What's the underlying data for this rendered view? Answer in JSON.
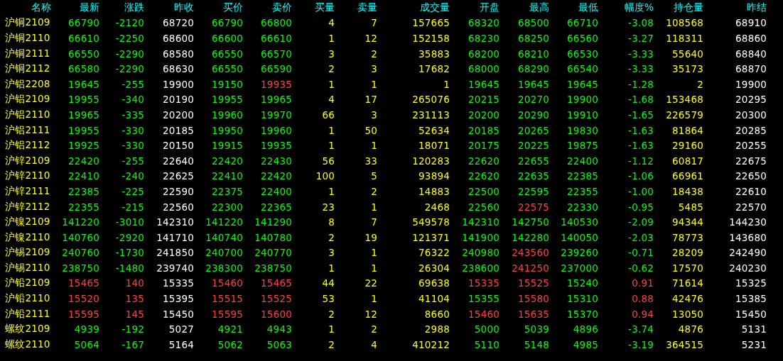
{
  "table": {
    "columns": [
      "名称",
      "最新",
      "涨跌",
      "昨收",
      "买价",
      "卖价",
      "买量",
      "卖量",
      "成交量",
      "开盘",
      "最高",
      "最低",
      "幅度%",
      "持仓量",
      "昨结"
    ],
    "rows": [
      {
        "cells": [
          {
            "text": "沪铜2109",
            "color": "#ffff00"
          },
          {
            "text": "66790",
            "color": "#00ff00"
          },
          {
            "text": "-2120",
            "color": "#00ff00"
          },
          {
            "text": "68720",
            "color": "#ffffff"
          },
          {
            "text": "66790",
            "color": "#00ff00"
          },
          {
            "text": "66800",
            "color": "#00ff00"
          },
          {
            "text": "4",
            "color": "#ffff00"
          },
          {
            "text": "7",
            "color": "#ffff00"
          },
          {
            "text": "157665",
            "color": "#ffff00"
          },
          {
            "text": "68320",
            "color": "#00ff00"
          },
          {
            "text": "68500",
            "color": "#00ff00"
          },
          {
            "text": "66710",
            "color": "#00ff00"
          },
          {
            "text": "-3.08",
            "color": "#00ff00"
          },
          {
            "text": "108568",
            "color": "#ffff00"
          },
          {
            "text": "68910",
            "color": "#ffffff"
          }
        ]
      },
      {
        "cells": [
          {
            "text": "沪铜2110",
            "color": "#ffff00"
          },
          {
            "text": "66610",
            "color": "#00ff00"
          },
          {
            "text": "-2250",
            "color": "#00ff00"
          },
          {
            "text": "68600",
            "color": "#ffffff"
          },
          {
            "text": "66600",
            "color": "#00ff00"
          },
          {
            "text": "66610",
            "color": "#00ff00"
          },
          {
            "text": "1",
            "color": "#ffff00"
          },
          {
            "text": "12",
            "color": "#ffff00"
          },
          {
            "text": "152158",
            "color": "#ffff00"
          },
          {
            "text": "68230",
            "color": "#00ff00"
          },
          {
            "text": "68250",
            "color": "#00ff00"
          },
          {
            "text": "66560",
            "color": "#00ff00"
          },
          {
            "text": "-3.27",
            "color": "#00ff00"
          },
          {
            "text": "118311",
            "color": "#ffff00"
          },
          {
            "text": "68860",
            "color": "#ffffff"
          }
        ]
      },
      {
        "cells": [
          {
            "text": "沪铜2111",
            "color": "#ffff00"
          },
          {
            "text": "66550",
            "color": "#00ff00"
          },
          {
            "text": "-2290",
            "color": "#00ff00"
          },
          {
            "text": "68580",
            "color": "#ffffff"
          },
          {
            "text": "66550",
            "color": "#00ff00"
          },
          {
            "text": "66570",
            "color": "#00ff00"
          },
          {
            "text": "3",
            "color": "#ffff00"
          },
          {
            "text": "2",
            "color": "#ffff00"
          },
          {
            "text": "35883",
            "color": "#ffff00"
          },
          {
            "text": "68200",
            "color": "#00ff00"
          },
          {
            "text": "68210",
            "color": "#00ff00"
          },
          {
            "text": "66530",
            "color": "#00ff00"
          },
          {
            "text": "-3.33",
            "color": "#00ff00"
          },
          {
            "text": "55640",
            "color": "#ffff00"
          },
          {
            "text": "68840",
            "color": "#ffffff"
          }
        ]
      },
      {
        "cells": [
          {
            "text": "沪铜2112",
            "color": "#ffff00"
          },
          {
            "text": "66580",
            "color": "#00ff00"
          },
          {
            "text": "-2290",
            "color": "#00ff00"
          },
          {
            "text": "68630",
            "color": "#ffffff"
          },
          {
            "text": "66550",
            "color": "#00ff00"
          },
          {
            "text": "66590",
            "color": "#00ff00"
          },
          {
            "text": "2",
            "color": "#ffff00"
          },
          {
            "text": "3",
            "color": "#ffff00"
          },
          {
            "text": "17682",
            "color": "#ffff00"
          },
          {
            "text": "68000",
            "color": "#00ff00"
          },
          {
            "text": "68290",
            "color": "#00ff00"
          },
          {
            "text": "66540",
            "color": "#00ff00"
          },
          {
            "text": "-3.33",
            "color": "#00ff00"
          },
          {
            "text": "35173",
            "color": "#ffff00"
          },
          {
            "text": "68870",
            "color": "#ffffff"
          }
        ]
      },
      {
        "cells": [
          {
            "text": "沪铝2208",
            "color": "#ffff00"
          },
          {
            "text": "19645",
            "color": "#00ff00"
          },
          {
            "text": "-255",
            "color": "#00ff00"
          },
          {
            "text": "19900",
            "color": "#ffffff"
          },
          {
            "text": "19150",
            "color": "#00ff00"
          },
          {
            "text": "19935",
            "color": "#ff4040"
          },
          {
            "text": "1",
            "color": "#ffff00"
          },
          {
            "text": "1",
            "color": "#ffff00"
          },
          {
            "text": "1",
            "color": "#ffff00"
          },
          {
            "text": "19645",
            "color": "#00ff00"
          },
          {
            "text": "19645",
            "color": "#00ff00"
          },
          {
            "text": "19645",
            "color": "#00ff00"
          },
          {
            "text": "-1.28",
            "color": "#00ff00"
          },
          {
            "text": "2",
            "color": "#ffff00"
          },
          {
            "text": "19900",
            "color": "#ffffff"
          }
        ]
      },
      {
        "cells": [
          {
            "text": "沪铝2109",
            "color": "#ffff00"
          },
          {
            "text": "19955",
            "color": "#00ff00"
          },
          {
            "text": "-340",
            "color": "#00ff00"
          },
          {
            "text": "20190",
            "color": "#ffffff"
          },
          {
            "text": "19955",
            "color": "#00ff00"
          },
          {
            "text": "19965",
            "color": "#00ff00"
          },
          {
            "text": "4",
            "color": "#ffff00"
          },
          {
            "text": "17",
            "color": "#ffff00"
          },
          {
            "text": "265076",
            "color": "#ffff00"
          },
          {
            "text": "20215",
            "color": "#00ff00"
          },
          {
            "text": "20270",
            "color": "#00ff00"
          },
          {
            "text": "19900",
            "color": "#00ff00"
          },
          {
            "text": "-1.68",
            "color": "#00ff00"
          },
          {
            "text": "153468",
            "color": "#ffff00"
          },
          {
            "text": "20295",
            "color": "#ffffff"
          }
        ]
      },
      {
        "cells": [
          {
            "text": "沪铝2110",
            "color": "#ffff00"
          },
          {
            "text": "19965",
            "color": "#00ff00"
          },
          {
            "text": "-335",
            "color": "#00ff00"
          },
          {
            "text": "20200",
            "color": "#ffffff"
          },
          {
            "text": "19960",
            "color": "#00ff00"
          },
          {
            "text": "19970",
            "color": "#00ff00"
          },
          {
            "text": "66",
            "color": "#ffff00"
          },
          {
            "text": "3",
            "color": "#ffff00"
          },
          {
            "text": "231113",
            "color": "#ffff00"
          },
          {
            "text": "20200",
            "color": "#00ff00"
          },
          {
            "text": "20290",
            "color": "#00ff00"
          },
          {
            "text": "19910",
            "color": "#00ff00"
          },
          {
            "text": "-1.65",
            "color": "#00ff00"
          },
          {
            "text": "226579",
            "color": "#ffff00"
          },
          {
            "text": "20300",
            "color": "#ffffff"
          }
        ]
      },
      {
        "cells": [
          {
            "text": "沪铝2111",
            "color": "#ffff00"
          },
          {
            "text": "19955",
            "color": "#00ff00"
          },
          {
            "text": "-330",
            "color": "#00ff00"
          },
          {
            "text": "20185",
            "color": "#ffffff"
          },
          {
            "text": "19950",
            "color": "#00ff00"
          },
          {
            "text": "19960",
            "color": "#00ff00"
          },
          {
            "text": "1",
            "color": "#ffff00"
          },
          {
            "text": "50",
            "color": "#ffff00"
          },
          {
            "text": "52634",
            "color": "#ffff00"
          },
          {
            "text": "20185",
            "color": "#00ff00"
          },
          {
            "text": "20265",
            "color": "#00ff00"
          },
          {
            "text": "19830",
            "color": "#00ff00"
          },
          {
            "text": "-1.63",
            "color": "#00ff00"
          },
          {
            "text": "81864",
            "color": "#ffff00"
          },
          {
            "text": "20285",
            "color": "#ffffff"
          }
        ]
      },
      {
        "cells": [
          {
            "text": "沪铝2112",
            "color": "#ffff00"
          },
          {
            "text": "19925",
            "color": "#00ff00"
          },
          {
            "text": "-330",
            "color": "#00ff00"
          },
          {
            "text": "20150",
            "color": "#ffffff"
          },
          {
            "text": "19915",
            "color": "#00ff00"
          },
          {
            "text": "19935",
            "color": "#00ff00"
          },
          {
            "text": "1",
            "color": "#ffff00"
          },
          {
            "text": "1",
            "color": "#ffff00"
          },
          {
            "text": "18071",
            "color": "#ffff00"
          },
          {
            "text": "20175",
            "color": "#00ff00"
          },
          {
            "text": "20225",
            "color": "#00ff00"
          },
          {
            "text": "19875",
            "color": "#00ff00"
          },
          {
            "text": "-1.63",
            "color": "#00ff00"
          },
          {
            "text": "29160",
            "color": "#ffff00"
          },
          {
            "text": "20255",
            "color": "#ffffff"
          }
        ]
      },
      {
        "cells": [
          {
            "text": "沪锌2109",
            "color": "#ffff00"
          },
          {
            "text": "22420",
            "color": "#00ff00"
          },
          {
            "text": "-255",
            "color": "#00ff00"
          },
          {
            "text": "22640",
            "color": "#ffffff"
          },
          {
            "text": "22420",
            "color": "#00ff00"
          },
          {
            "text": "22430",
            "color": "#00ff00"
          },
          {
            "text": "56",
            "color": "#ffff00"
          },
          {
            "text": "33",
            "color": "#ffff00"
          },
          {
            "text": "120283",
            "color": "#ffff00"
          },
          {
            "text": "22620",
            "color": "#00ff00"
          },
          {
            "text": "22655",
            "color": "#00ff00"
          },
          {
            "text": "22400",
            "color": "#00ff00"
          },
          {
            "text": "-1.12",
            "color": "#00ff00"
          },
          {
            "text": "60817",
            "color": "#ffff00"
          },
          {
            "text": "22675",
            "color": "#ffffff"
          }
        ]
      },
      {
        "cells": [
          {
            "text": "沪锌2110",
            "color": "#ffff00"
          },
          {
            "text": "22410",
            "color": "#00ff00"
          },
          {
            "text": "-240",
            "color": "#00ff00"
          },
          {
            "text": "22625",
            "color": "#ffffff"
          },
          {
            "text": "22410",
            "color": "#00ff00"
          },
          {
            "text": "22420",
            "color": "#00ff00"
          },
          {
            "text": "100",
            "color": "#ffff00"
          },
          {
            "text": "5",
            "color": "#ffff00"
          },
          {
            "text": "93894",
            "color": "#ffff00"
          },
          {
            "text": "22620",
            "color": "#00ff00"
          },
          {
            "text": "22635",
            "color": "#00ff00"
          },
          {
            "text": "22385",
            "color": "#00ff00"
          },
          {
            "text": "-1.06",
            "color": "#00ff00"
          },
          {
            "text": "66961",
            "color": "#ffff00"
          },
          {
            "text": "22650",
            "color": "#ffffff"
          }
        ]
      },
      {
        "cells": [
          {
            "text": "沪锌2111",
            "color": "#ffff00"
          },
          {
            "text": "22385",
            "color": "#00ff00"
          },
          {
            "text": "-225",
            "color": "#00ff00"
          },
          {
            "text": "22590",
            "color": "#ffffff"
          },
          {
            "text": "22375",
            "color": "#00ff00"
          },
          {
            "text": "22400",
            "color": "#00ff00"
          },
          {
            "text": "1",
            "color": "#ffff00"
          },
          {
            "text": "2",
            "color": "#ffff00"
          },
          {
            "text": "14883",
            "color": "#ffff00"
          },
          {
            "text": "22500",
            "color": "#00ff00"
          },
          {
            "text": "22595",
            "color": "#00ff00"
          },
          {
            "text": "22355",
            "color": "#00ff00"
          },
          {
            "text": "-1.00",
            "color": "#00ff00"
          },
          {
            "text": "18438",
            "color": "#ffff00"
          },
          {
            "text": "22610",
            "color": "#ffffff"
          }
        ]
      },
      {
        "cells": [
          {
            "text": "沪锌2112",
            "color": "#ffff00"
          },
          {
            "text": "22355",
            "color": "#00ff00"
          },
          {
            "text": "-215",
            "color": "#00ff00"
          },
          {
            "text": "22560",
            "color": "#ffffff"
          },
          {
            "text": "22300",
            "color": "#00ff00"
          },
          {
            "text": "22365",
            "color": "#00ff00"
          },
          {
            "text": "23",
            "color": "#ffff00"
          },
          {
            "text": "1",
            "color": "#ffff00"
          },
          {
            "text": "2468",
            "color": "#ffff00"
          },
          {
            "text": "22560",
            "color": "#00ff00"
          },
          {
            "text": "22575",
            "color": "#ff4040"
          },
          {
            "text": "22330",
            "color": "#00ff00"
          },
          {
            "text": "-0.95",
            "color": "#00ff00"
          },
          {
            "text": "5485",
            "color": "#ffff00"
          },
          {
            "text": "22570",
            "color": "#ffffff"
          }
        ]
      },
      {
        "cells": [
          {
            "text": "沪镍2109",
            "color": "#ffff00"
          },
          {
            "text": "141220",
            "color": "#00ff00"
          },
          {
            "text": "-3010",
            "color": "#00ff00"
          },
          {
            "text": "142310",
            "color": "#ffffff"
          },
          {
            "text": "141220",
            "color": "#00ff00"
          },
          {
            "text": "141290",
            "color": "#00ff00"
          },
          {
            "text": "8",
            "color": "#ffff00"
          },
          {
            "text": "7",
            "color": "#ffff00"
          },
          {
            "text": "549578",
            "color": "#ffff00"
          },
          {
            "text": "142310",
            "color": "#00ff00"
          },
          {
            "text": "142750",
            "color": "#00ff00"
          },
          {
            "text": "140530",
            "color": "#00ff00"
          },
          {
            "text": "-2.09",
            "color": "#00ff00"
          },
          {
            "text": "94344",
            "color": "#ffff00"
          },
          {
            "text": "144230",
            "color": "#ffffff"
          }
        ]
      },
      {
        "cells": [
          {
            "text": "沪镍2110",
            "color": "#ffff00"
          },
          {
            "text": "140760",
            "color": "#00ff00"
          },
          {
            "text": "-2920",
            "color": "#00ff00"
          },
          {
            "text": "141710",
            "color": "#ffffff"
          },
          {
            "text": "140740",
            "color": "#00ff00"
          },
          {
            "text": "140780",
            "color": "#00ff00"
          },
          {
            "text": "2",
            "color": "#ffff00"
          },
          {
            "text": "19",
            "color": "#ffff00"
          },
          {
            "text": "121371",
            "color": "#ffff00"
          },
          {
            "text": "141900",
            "color": "#00ff00"
          },
          {
            "text": "142280",
            "color": "#00ff00"
          },
          {
            "text": "140050",
            "color": "#00ff00"
          },
          {
            "text": "-2.03",
            "color": "#00ff00"
          },
          {
            "text": "78773",
            "color": "#ffff00"
          },
          {
            "text": "143680",
            "color": "#ffffff"
          }
        ]
      },
      {
        "cells": [
          {
            "text": "沪锡2109",
            "color": "#ffff00"
          },
          {
            "text": "240760",
            "color": "#00ff00"
          },
          {
            "text": "-1730",
            "color": "#00ff00"
          },
          {
            "text": "241850",
            "color": "#ffffff"
          },
          {
            "text": "240700",
            "color": "#00ff00"
          },
          {
            "text": "240770",
            "color": "#00ff00"
          },
          {
            "text": "3",
            "color": "#ffff00"
          },
          {
            "text": "1",
            "color": "#ffff00"
          },
          {
            "text": "76322",
            "color": "#ffff00"
          },
          {
            "text": "240980",
            "color": "#00ff00"
          },
          {
            "text": "243560",
            "color": "#ff4040"
          },
          {
            "text": "239260",
            "color": "#00ff00"
          },
          {
            "text": "-0.71",
            "color": "#00ff00"
          },
          {
            "text": "28209",
            "color": "#ffff00"
          },
          {
            "text": "242490",
            "color": "#ffffff"
          }
        ]
      },
      {
        "cells": [
          {
            "text": "沪锡2110",
            "color": "#ffff00"
          },
          {
            "text": "238750",
            "color": "#00ff00"
          },
          {
            "text": "-1480",
            "color": "#00ff00"
          },
          {
            "text": "239740",
            "color": "#ffffff"
          },
          {
            "text": "238300",
            "color": "#00ff00"
          },
          {
            "text": "238750",
            "color": "#00ff00"
          },
          {
            "text": "1",
            "color": "#ffff00"
          },
          {
            "text": "1",
            "color": "#ffff00"
          },
          {
            "text": "26304",
            "color": "#ffff00"
          },
          {
            "text": "238600",
            "color": "#00ff00"
          },
          {
            "text": "241250",
            "color": "#ff4040"
          },
          {
            "text": "237000",
            "color": "#00ff00"
          },
          {
            "text": "-0.62",
            "color": "#00ff00"
          },
          {
            "text": "17570",
            "color": "#ffff00"
          },
          {
            "text": "240230",
            "color": "#ffffff"
          }
        ]
      },
      {
        "cells": [
          {
            "text": "沪铅2109",
            "color": "#ffff00"
          },
          {
            "text": "15465",
            "color": "#ff4040"
          },
          {
            "text": "140",
            "color": "#ff4040"
          },
          {
            "text": "15335",
            "color": "#ffffff"
          },
          {
            "text": "15460",
            "color": "#ff4040"
          },
          {
            "text": "15465",
            "color": "#ff4040"
          },
          {
            "text": "44",
            "color": "#ffff00"
          },
          {
            "text": "22",
            "color": "#ffff00"
          },
          {
            "text": "69638",
            "color": "#ffff00"
          },
          {
            "text": "15335",
            "color": "#ff4040"
          },
          {
            "text": "15525",
            "color": "#ff4040"
          },
          {
            "text": "15240",
            "color": "#00ff00"
          },
          {
            "text": "0.91",
            "color": "#ff4040"
          },
          {
            "text": "71614",
            "color": "#ffff00"
          },
          {
            "text": "15325",
            "color": "#ffffff"
          }
        ]
      },
      {
        "cells": [
          {
            "text": "沪铅2110",
            "color": "#ffff00"
          },
          {
            "text": "15520",
            "color": "#ff4040"
          },
          {
            "text": "135",
            "color": "#ff4040"
          },
          {
            "text": "15395",
            "color": "#ffffff"
          },
          {
            "text": "15515",
            "color": "#ff4040"
          },
          {
            "text": "15525",
            "color": "#ff4040"
          },
          {
            "text": "53",
            "color": "#ffff00"
          },
          {
            "text": "1",
            "color": "#ffff00"
          },
          {
            "text": "41104",
            "color": "#ffff00"
          },
          {
            "text": "15355",
            "color": "#00ff00"
          },
          {
            "text": "15580",
            "color": "#ff4040"
          },
          {
            "text": "15310",
            "color": "#00ff00"
          },
          {
            "text": "0.88",
            "color": "#ff4040"
          },
          {
            "text": "42476",
            "color": "#ffff00"
          },
          {
            "text": "15385",
            "color": "#ffffff"
          }
        ]
      },
      {
        "cells": [
          {
            "text": "沪铅2111",
            "color": "#ffff00"
          },
          {
            "text": "15595",
            "color": "#ff4040"
          },
          {
            "text": "145",
            "color": "#ff4040"
          },
          {
            "text": "15450",
            "color": "#ffffff"
          },
          {
            "text": "15595",
            "color": "#ff4040"
          },
          {
            "text": "15600",
            "color": "#ff4040"
          },
          {
            "text": "2",
            "color": "#ffff00"
          },
          {
            "text": "12",
            "color": "#ffff00"
          },
          {
            "text": "8660",
            "color": "#ffff00"
          },
          {
            "text": "15460",
            "color": "#ff4040"
          },
          {
            "text": "15635",
            "color": "#ff4040"
          },
          {
            "text": "15370",
            "color": "#00ff00"
          },
          {
            "text": "0.94",
            "color": "#ff4040"
          },
          {
            "text": "13050",
            "color": "#ffff00"
          },
          {
            "text": "15450",
            "color": "#ffffff"
          }
        ]
      },
      {
        "cells": [
          {
            "text": "螺纹2109",
            "color": "#ffff00"
          },
          {
            "text": "4939",
            "color": "#00ff00"
          },
          {
            "text": "-192",
            "color": "#00ff00"
          },
          {
            "text": "5027",
            "color": "#ffffff"
          },
          {
            "text": "4921",
            "color": "#00ff00"
          },
          {
            "text": "4943",
            "color": "#00ff00"
          },
          {
            "text": "1",
            "color": "#ffff00"
          },
          {
            "text": "2",
            "color": "#ffff00"
          },
          {
            "text": "2988",
            "color": "#ffff00"
          },
          {
            "text": "5000",
            "color": "#00ff00"
          },
          {
            "text": "5039",
            "color": "#00ff00"
          },
          {
            "text": "4896",
            "color": "#00ff00"
          },
          {
            "text": "-3.74",
            "color": "#00ff00"
          },
          {
            "text": "4876",
            "color": "#ffff00"
          },
          {
            "text": "5131",
            "color": "#ffffff"
          }
        ]
      },
      {
        "cells": [
          {
            "text": "螺纹2110",
            "color": "#ffff00"
          },
          {
            "text": "5064",
            "color": "#00ff00"
          },
          {
            "text": "-167",
            "color": "#00ff00"
          },
          {
            "text": "5164",
            "color": "#ffffff"
          },
          {
            "text": "5062",
            "color": "#00ff00"
          },
          {
            "text": "5063",
            "color": "#00ff00"
          },
          {
            "text": "2",
            "color": "#ffff00"
          },
          {
            "text": "4",
            "color": "#ffff00"
          },
          {
            "text": "410212",
            "color": "#ffff00"
          },
          {
            "text": "5110",
            "color": "#00ff00"
          },
          {
            "text": "5148",
            "color": "#00ff00"
          },
          {
            "text": "4985",
            "color": "#00ff00"
          },
          {
            "text": "-3.19",
            "color": "#00ff00"
          },
          {
            "text": "364515",
            "color": "#ffff00"
          },
          {
            "text": "5231",
            "color": "#ffffff"
          }
        ]
      }
    ]
  }
}
